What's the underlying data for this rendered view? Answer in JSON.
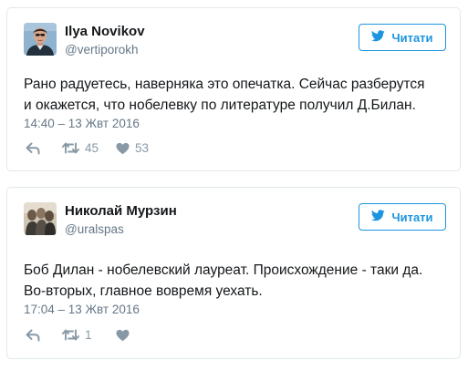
{
  "tweets": [
    {
      "name": "Ilya Novikov",
      "handle": "@vertiporokh",
      "follow_label": "Читати",
      "text_lines": [
        "Рано радуетесь, наверняка это опечатка. Сейчас разберутся",
        "и окажется, что нобелевку по литературе получил Д.Билан."
      ],
      "timestamp": "14:40 – 13 Жвт 2016",
      "retweets": "45",
      "likes": "53"
    },
    {
      "name": "Николай Мурзин",
      "handle": "@uralspas",
      "follow_label": "Читати",
      "text_lines": [
        "Боб Дилан - нобелевский лауреат. Происхождение - таки да.",
        "Во-вторых, главное вовремя уехать."
      ],
      "timestamp": "17:04 – 13 Жвт 2016",
      "retweets": "1",
      "likes": ""
    }
  ],
  "colors": {
    "accent": "#1b95e0",
    "muted": "#657786",
    "icon": "#8899a6",
    "border": "#e1e8ed"
  },
  "icons": {
    "follow": "twitter-bird-icon",
    "reply": "reply-icon",
    "retweet": "retweet-icon",
    "like": "heart-icon"
  }
}
